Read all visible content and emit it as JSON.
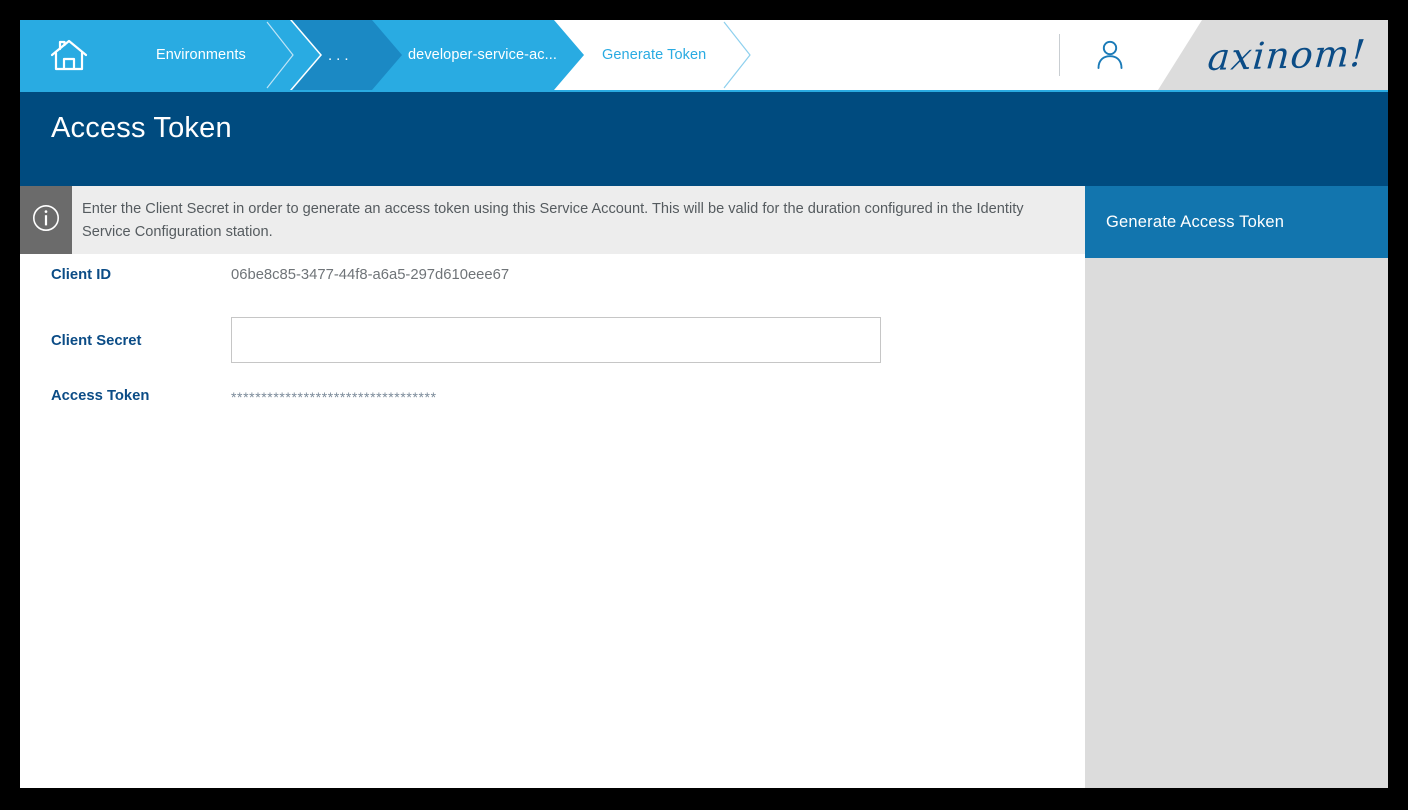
{
  "breadcrumb": {
    "home_icon": "home-icon",
    "items": [
      {
        "label": "Environments",
        "state": "inactive"
      },
      {
        "label": "...",
        "state": "ellipsis"
      },
      {
        "label": "developer-service-ac...",
        "state": "inactive"
      },
      {
        "label": "Generate Token",
        "state": "active"
      }
    ]
  },
  "header": {
    "account_icon": "user-account-icon",
    "logo_text": "axinom!"
  },
  "page": {
    "title": "Access Token"
  },
  "info": {
    "icon": "info-circle-icon",
    "message": "Enter the Client Secret in order to generate an access token using this Service Account. This will be valid for the duration configured in the Identity Service Configuration station."
  },
  "form": {
    "fields": [
      {
        "label": "Client ID",
        "value": "06be8c85-3477-44f8-a6a5-297d610eee67",
        "type": "readonly-text"
      },
      {
        "label": "Client Secret",
        "value": "",
        "placeholder": "",
        "type": "text-input"
      },
      {
        "label": "Access Token",
        "value": "**********************************",
        "type": "masked-text"
      }
    ]
  },
  "actions": {
    "generate_token_label": "Generate Access Token"
  },
  "colors": {
    "header_blue": "#29ABE2",
    "header_blue_dark": "#1B89C4",
    "title_navy": "#004B7F",
    "button_blue": "#1275AE",
    "panel_gray": "#DCDCDC",
    "info_gray": "#ededed",
    "info_icon_gray": "#6B6B6B",
    "label_navy": "#0B4C86",
    "logo_navy": "#0B4C86"
  }
}
